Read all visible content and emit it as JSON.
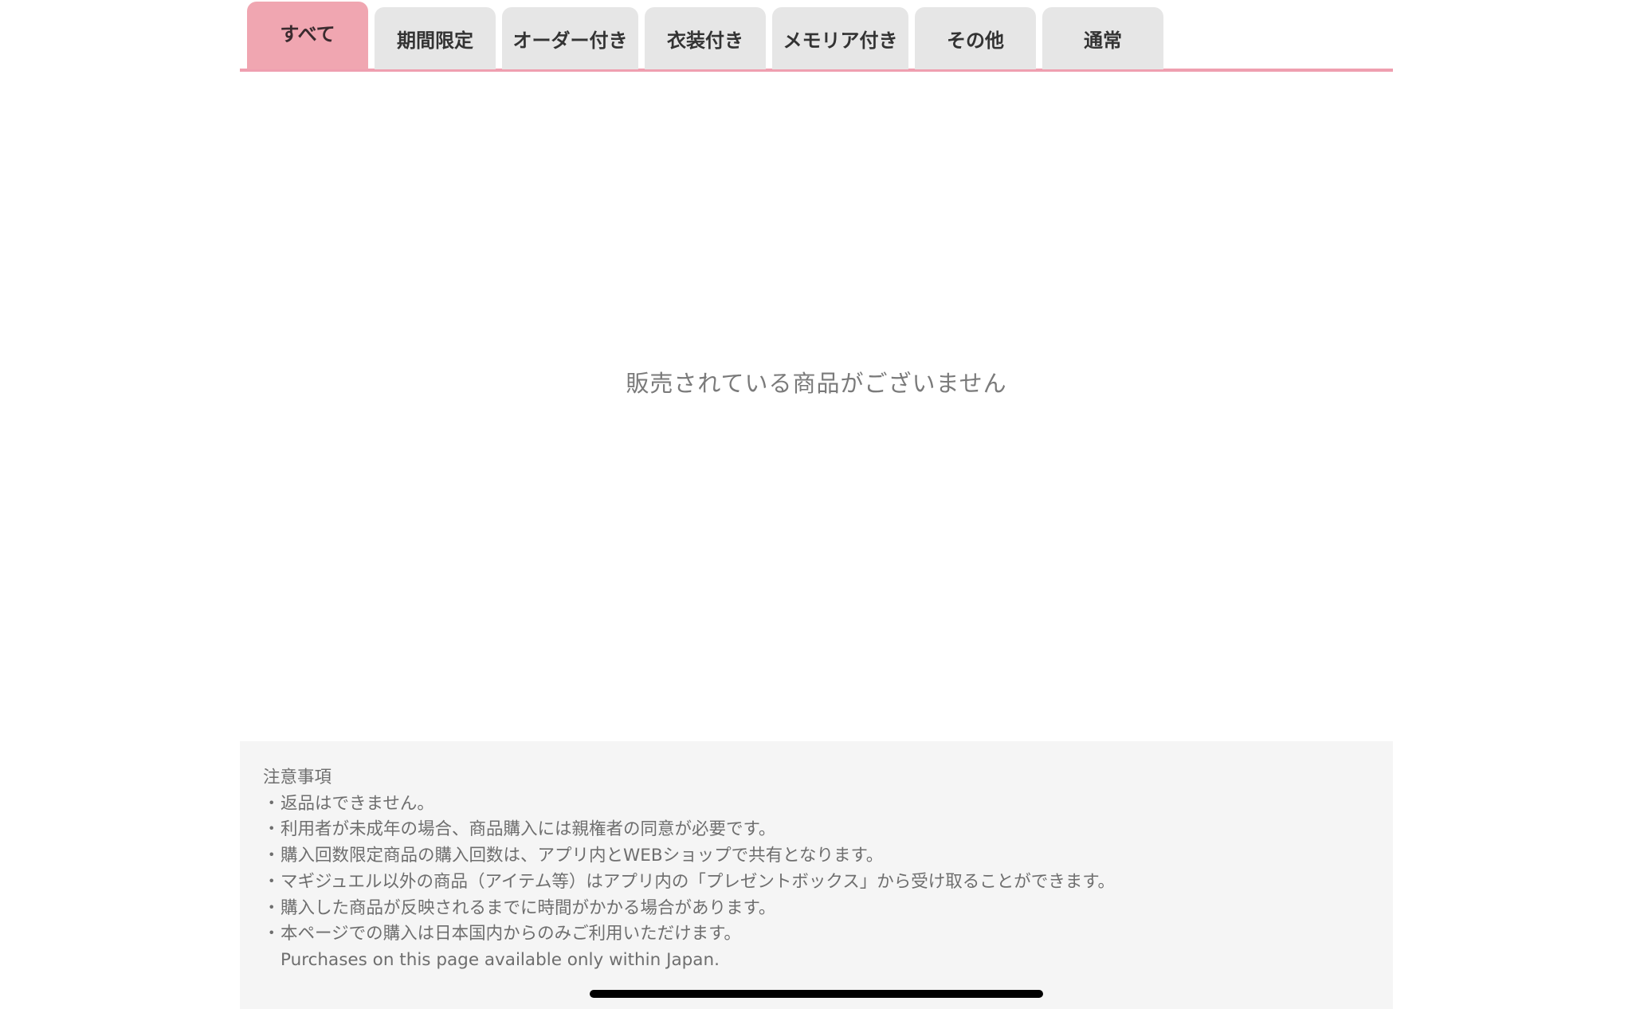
{
  "tabs": [
    {
      "label": "すべて",
      "active": true
    },
    {
      "label": "期間限定",
      "active": false
    },
    {
      "label": "オーダー付き",
      "active": false
    },
    {
      "label": "衣装付き",
      "active": false
    },
    {
      "label": "メモリア付き",
      "active": false
    },
    {
      "label": "その他",
      "active": false
    },
    {
      "label": "通常",
      "active": false
    }
  ],
  "main": {
    "empty_message": "販売されている商品がございません"
  },
  "notes": {
    "title": "注意事項",
    "bullet": "・",
    "items": [
      "返品はできません。",
      "利用者が未成年の場合、商品購入には親権者の同意が必要です。",
      "購入回数限定商品の購入回数は、アプリ内とWEBショップで共有となります。",
      "マギジュエル以外の商品（アイテム等）はアプリ内の「プレゼントボックス」から受け取ることができます。",
      "購入した商品が反映されるまでに時間がかかる場合があります。",
      "本ページでの購入は日本国内からのみご利用いただけます。"
    ],
    "english_note": "Purchases on this page available only within Japan."
  },
  "colors": {
    "accent_pink": "#ef9fb0",
    "active_tab": "#f0a6b1",
    "inactive_tab": "#e6e6e6",
    "notes_background": "#f5f5f5"
  }
}
